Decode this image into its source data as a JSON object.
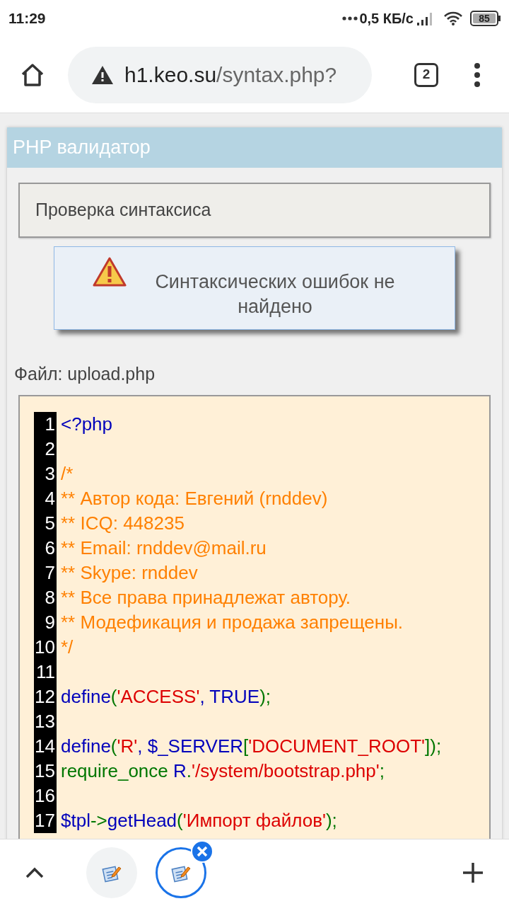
{
  "status_bar": {
    "time": "11:29",
    "speed": "0,5 КБ/с",
    "battery": "85"
  },
  "browser": {
    "url_host": "h1.keo.su",
    "url_path": "/syntax.php?",
    "tab_count": "2"
  },
  "page": {
    "title": "PHP валидатор",
    "section": "Проверка синтаксиса",
    "notice": "Синтаксических ошибок не найдено",
    "file_label": "Файл: upload.php"
  },
  "code_lines": [
    {
      "number": "1",
      "tokens": [
        {
          "kind": "keyword",
          "text": "<?php"
        }
      ]
    },
    {
      "number": "2"
    },
    {
      "number": "3",
      "tokens": [
        {
          "kind": "comment",
          "text": "/*"
        }
      ]
    },
    {
      "number": "4",
      "tokens": [
        {
          "kind": "comment",
          "text": "** Автор кода: Евгений (rnddev)"
        }
      ]
    },
    {
      "number": "5",
      "tokens": [
        {
          "kind": "comment",
          "text": "** ICQ: 448235"
        }
      ]
    },
    {
      "number": "6",
      "tokens": [
        {
          "kind": "comment",
          "text": "** Email: rnddev@mail.ru"
        }
      ]
    },
    {
      "number": "7",
      "tokens": [
        {
          "kind": "comment",
          "text": "** Skype: rnddev"
        }
      ]
    },
    {
      "number": "8",
      "tokens": [
        {
          "kind": "comment",
          "text": "** Все права принадлежат автору."
        }
      ]
    },
    {
      "number": "9",
      "tokens": [
        {
          "kind": "comment",
          "text": "** Модефикация и продажа запрещены."
        }
      ]
    },
    {
      "number": "10",
      "tokens": [
        {
          "kind": "comment",
          "text": "*/"
        }
      ]
    },
    {
      "number": "11"
    },
    {
      "number": "12",
      "tokens": [
        {
          "kind": "keyword",
          "text": "define"
        },
        {
          "kind": "punct",
          "text": "("
        },
        {
          "kind": "string",
          "text": "'ACCESS'"
        },
        {
          "kind": "keyword",
          "text": ", TRUE"
        },
        {
          "kind": "punct",
          "text": ");"
        }
      ]
    },
    {
      "number": "13"
    },
    {
      "number": "14",
      "tokens": [
        {
          "kind": "keyword",
          "text": "define"
        },
        {
          "kind": "punct",
          "text": "("
        },
        {
          "kind": "string",
          "text": "'R'"
        },
        {
          "kind": "keyword",
          "text": ", $_SERVER"
        },
        {
          "kind": "punct",
          "text": "["
        },
        {
          "kind": "string",
          "text": "'DOCUMENT_ROOT'"
        },
        {
          "kind": "punct",
          "text": "]);"
        }
      ]
    },
    {
      "number": "15",
      "tokens": [
        {
          "kind": "punct",
          "text": "require_once "
        },
        {
          "kind": "keyword",
          "text": "R"
        },
        {
          "kind": "punct",
          "text": "."
        },
        {
          "kind": "string",
          "text": "'/system/bootstrap.php'"
        },
        {
          "kind": "punct",
          "text": ";"
        }
      ]
    },
    {
      "number": "16"
    },
    {
      "number": "17",
      "tokens": [
        {
          "kind": "keyword",
          "text": "$tpl"
        },
        {
          "kind": "punct",
          "text": "->"
        },
        {
          "kind": "keyword",
          "text": "getHead"
        },
        {
          "kind": "punct",
          "text": "("
        },
        {
          "kind": "string",
          "text": "'Импорт файлов'"
        },
        {
          "kind": "punct",
          "text": ");"
        }
      ]
    }
  ],
  "tabs": [
    {
      "selected": false
    },
    {
      "selected": true
    }
  ]
}
